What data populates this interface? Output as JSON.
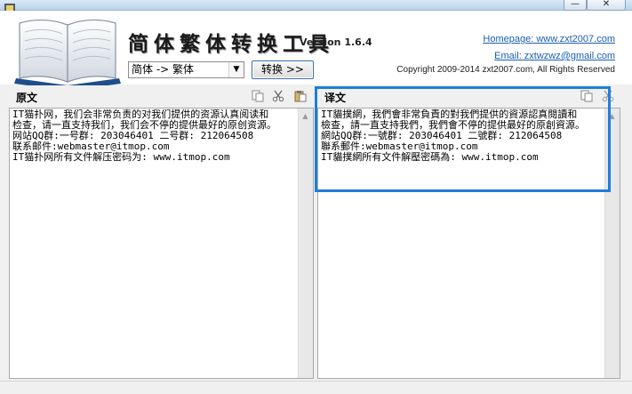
{
  "window": {
    "minimize_glyph": "—",
    "close_glyph": "✕"
  },
  "header": {
    "app_title": "简体繁体转换工具",
    "version": "Version 1.6.4",
    "mode_select_value": "简体 -> 繁体",
    "convert_button_label": "转换 >>",
    "homepage_link": "Homepage: www.zxt2007.com",
    "email_link": "Email: zxtwzwz@gmail.com",
    "copyright": "Copyright 2009-2014 zxt2007.com, All Rights Reserved"
  },
  "source_pane": {
    "title": "原文",
    "text": "IT猫扑网，我们会非常负责的对我们提供的资源认真阅读和\n检查，请一直支持我们，我们会不停的提供最好的原创资源。\n网站QQ群:一号群: 203046401 二号群: 212064508\n联系邮件:webmaster@itmop.com\nIT猫扑网所有文件解压密码为: www.itmop.com"
  },
  "target_pane": {
    "title": "译文",
    "text": "IT貓撲網，我們會非常負責的對我們提供的資源認真閱讀和\n檢查，請一直支持我們，我們會不停的提供最好的原創資源。\n網站QQ群:一號群: 203046401 二號群: 212064508\n聯系郵件:webmaster@itmop.com\nIT貓撲網所有文件解壓密碼為: www.itmop.com"
  },
  "icons": {
    "copy": "copy-icon",
    "cut": "cut-icon",
    "paste": "paste-icon"
  },
  "colors": {
    "highlight": "#1e7ddb",
    "link": "#1a5fb4"
  }
}
